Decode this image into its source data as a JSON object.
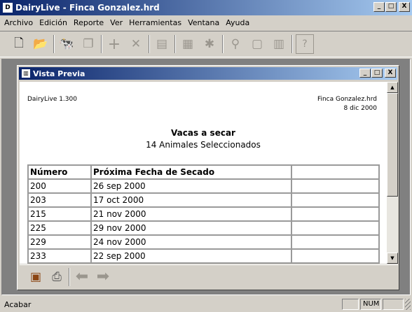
{
  "app": {
    "title": "DairyLive - Finca Gonzalez.hrd",
    "title_icon": "dairylive-app-icon",
    "window_buttons": [
      "_",
      "□",
      "X"
    ]
  },
  "menu": [
    "Archivo",
    "Edición",
    "Reporte",
    "Ver",
    "Herramientas",
    "Ventana",
    "Ayuda"
  ],
  "toolbar": {
    "icons": [
      "new-document-icon",
      "open-folder-icon",
      "animal-icon",
      "copy-icon",
      "add-icon",
      "delete-icon",
      "report-icon",
      "calendar-icon",
      "star-calendar-icon",
      "search-icon",
      "clipboard-icon",
      "chart-icon",
      "help-icon"
    ]
  },
  "child": {
    "title": "Vista Previa",
    "window_buttons": [
      "_",
      "□",
      "X"
    ]
  },
  "report": {
    "software": "DairyLive 1.300",
    "farm": "Finca Gonzalez.hrd",
    "date": "8 dic 2000",
    "title": "Vacas a secar",
    "subtitle": "14 Animales Seleccionados",
    "columns": [
      "Número",
      "Próxima Fecha de Secado",
      ""
    ],
    "rows": [
      [
        "200",
        "26 sep 2000",
        ""
      ],
      [
        "203",
        "17 oct 2000",
        ""
      ],
      [
        "215",
        "21 nov 2000",
        ""
      ],
      [
        "225",
        "29 nov 2000",
        ""
      ],
      [
        "229",
        "24 nov 2000",
        ""
      ],
      [
        "233",
        "22 sep 2000",
        ""
      ]
    ]
  },
  "preview_toolbar": {
    "icons": [
      "export-icon",
      "print-icon",
      "previous-page-icon",
      "next-page-icon"
    ]
  },
  "status": {
    "text": "Acabar",
    "num": "NUM"
  }
}
